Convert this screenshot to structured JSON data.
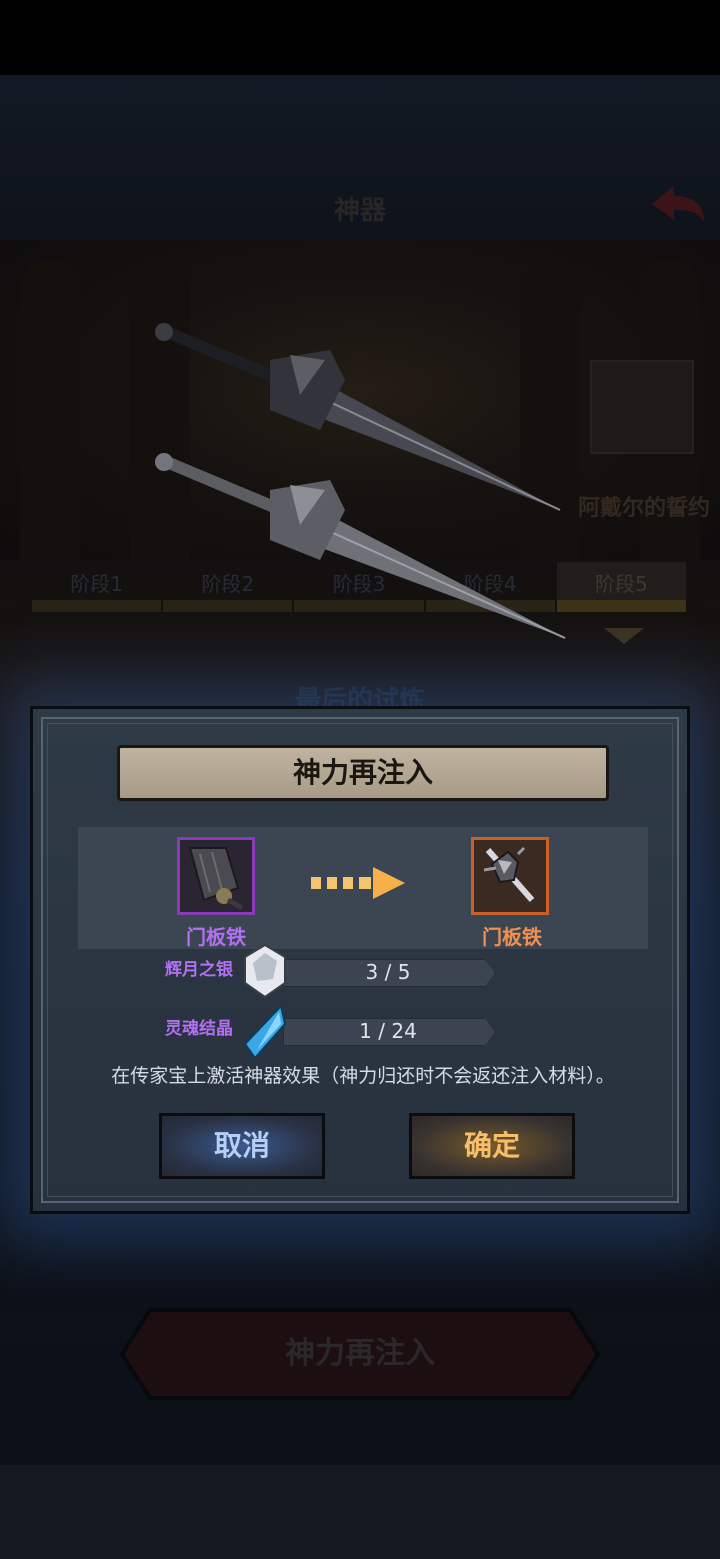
{
  "screen": {
    "title": "神器",
    "pact_name": "阿戴尔的誓约",
    "stages": [
      "阶段1",
      "阶段2",
      "阶段3",
      "阶段4",
      "阶段5"
    ],
    "active_stage": "阶段5",
    "trial_title": "最后的试炼",
    "bottom_button_label": "神力再注入"
  },
  "modal": {
    "title": "神力再注入",
    "source_item": {
      "name": "门板铁"
    },
    "target_item": {
      "name": "门板铁"
    },
    "materials": [
      {
        "name": "辉月之银",
        "count": "3 / 5",
        "icon": "silver-ore-icon"
      },
      {
        "name": "灵魂结晶",
        "count": "1 / 24",
        "icon": "soul-crystal-icon"
      }
    ],
    "description": "在传家宝上激活神器效果（神力归还时不会返还注入材料）。",
    "cancel_label": "取消",
    "confirm_label": "确定"
  },
  "colors": {
    "source_rarity": "#8a3ab8",
    "target_rarity": "#c8602a",
    "cancel_text": "#b6cff5",
    "confirm_text": "#f6c06a"
  }
}
